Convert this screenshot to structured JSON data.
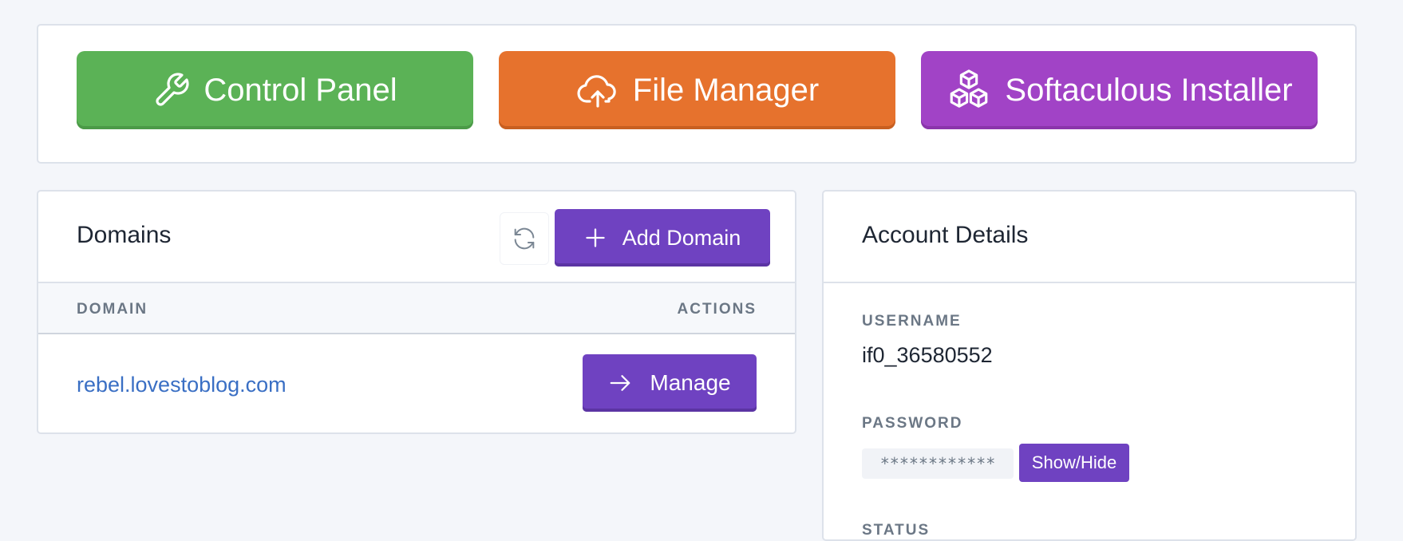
{
  "quick_actions": {
    "control_panel": {
      "label": "Control Panel",
      "icon": "wrench-icon",
      "color": "#5bb256"
    },
    "file_manager": {
      "label": "File Manager",
      "icon": "cloud-upload-icon",
      "color": "#e6722d"
    },
    "softaculous": {
      "label": "Softaculous Installer",
      "icon": "cubes-icon",
      "color": "#a143c6"
    }
  },
  "domains": {
    "title": "Domains",
    "refresh_icon": "refresh-icon",
    "add_label": "Add Domain",
    "columns": [
      "DOMAIN",
      "ACTIONS"
    ],
    "rows": [
      {
        "domain": "rebel.lovestoblog.com",
        "action_label": "Manage"
      }
    ]
  },
  "account": {
    "title": "Account Details",
    "username_label": "USERNAME",
    "username": "if0_36580552",
    "password_label": "PASSWORD",
    "password_masked": "************",
    "show_hide_label": "Show/Hide",
    "status_label": "STATUS"
  },
  "colors": {
    "accent_purple": "#6f42c1",
    "link_blue": "#3a6fc4",
    "background": "#f4f6fa"
  }
}
